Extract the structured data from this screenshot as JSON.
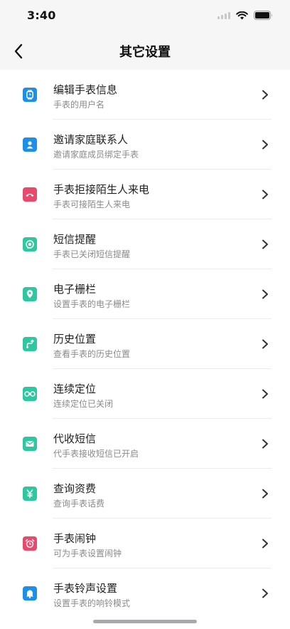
{
  "status_bar": {
    "time": "3:40"
  },
  "nav": {
    "title": "其它设置"
  },
  "items": [
    {
      "title": "编辑手表信息",
      "subtitle": "手表的用户名",
      "icon": "watch-icon",
      "color": "#1e8fe6"
    },
    {
      "title": "邀请家庭联系人",
      "subtitle": "邀请家庭成员绑定手表",
      "icon": "person-icon",
      "color": "#1e8fe6"
    },
    {
      "title": "手表拒接陌生人来电",
      "subtitle": "手表可接陌生人来电",
      "icon": "phone-reject-icon",
      "color": "#e84a6b"
    },
    {
      "title": "短信提醒",
      "subtitle": "手表已关闭短信提醒",
      "icon": "message-alert-icon",
      "color": "#2ec7a0"
    },
    {
      "title": "电子栅栏",
      "subtitle": "设置手表的电子栅栏",
      "icon": "geofence-icon",
      "color": "#2ec7a0"
    },
    {
      "title": "历史位置",
      "subtitle": "查看手表的历史位置",
      "icon": "history-location-icon",
      "color": "#2ec7a0"
    },
    {
      "title": "连续定位",
      "subtitle": "连续定位已关闭",
      "icon": "continuous-location-icon",
      "color": "#2ec7a0"
    },
    {
      "title": "代收短信",
      "subtitle": "代手表接收短信已开启",
      "icon": "envelope-icon",
      "color": "#2ec7a0"
    },
    {
      "title": "查询资费",
      "subtitle": "查询手表话费",
      "icon": "yuan-icon",
      "color": "#2ec7a0"
    },
    {
      "title": "手表闹钟",
      "subtitle": "可为手表设置闹钟",
      "icon": "alarm-clock-icon",
      "color": "#e84a6b"
    },
    {
      "title": "手表铃声设置",
      "subtitle": "设置手表的响铃模式",
      "icon": "bell-icon",
      "color": "#1e8fe6"
    }
  ]
}
